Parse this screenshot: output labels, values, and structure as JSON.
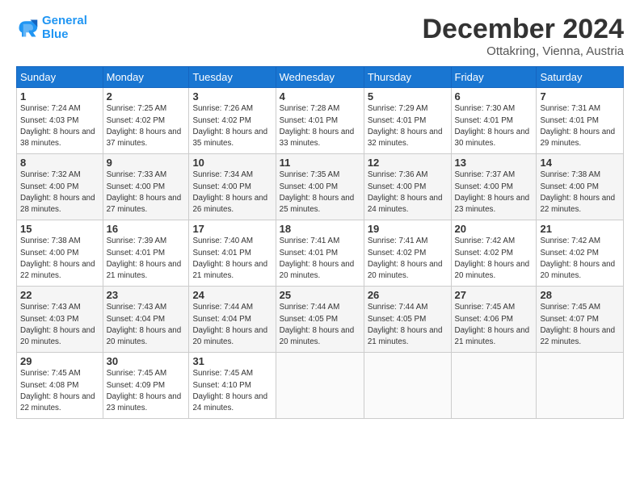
{
  "logo": {
    "line1": "General",
    "line2": "Blue"
  },
  "title": "December 2024",
  "subtitle": "Ottakring, Vienna, Austria",
  "days_of_week": [
    "Sunday",
    "Monday",
    "Tuesday",
    "Wednesday",
    "Thursday",
    "Friday",
    "Saturday"
  ],
  "weeks": [
    [
      {
        "day": "1",
        "sunrise": "7:24 AM",
        "sunset": "4:03 PM",
        "daylight": "8 hours and 38 minutes."
      },
      {
        "day": "2",
        "sunrise": "7:25 AM",
        "sunset": "4:02 PM",
        "daylight": "8 hours and 37 minutes."
      },
      {
        "day": "3",
        "sunrise": "7:26 AM",
        "sunset": "4:02 PM",
        "daylight": "8 hours and 35 minutes."
      },
      {
        "day": "4",
        "sunrise": "7:28 AM",
        "sunset": "4:01 PM",
        "daylight": "8 hours and 33 minutes."
      },
      {
        "day": "5",
        "sunrise": "7:29 AM",
        "sunset": "4:01 PM",
        "daylight": "8 hours and 32 minutes."
      },
      {
        "day": "6",
        "sunrise": "7:30 AM",
        "sunset": "4:01 PM",
        "daylight": "8 hours and 30 minutes."
      },
      {
        "day": "7",
        "sunrise": "7:31 AM",
        "sunset": "4:01 PM",
        "daylight": "8 hours and 29 minutes."
      }
    ],
    [
      {
        "day": "8",
        "sunrise": "7:32 AM",
        "sunset": "4:00 PM",
        "daylight": "8 hours and 28 minutes."
      },
      {
        "day": "9",
        "sunrise": "7:33 AM",
        "sunset": "4:00 PM",
        "daylight": "8 hours and 27 minutes."
      },
      {
        "day": "10",
        "sunrise": "7:34 AM",
        "sunset": "4:00 PM",
        "daylight": "8 hours and 26 minutes."
      },
      {
        "day": "11",
        "sunrise": "7:35 AM",
        "sunset": "4:00 PM",
        "daylight": "8 hours and 25 minutes."
      },
      {
        "day": "12",
        "sunrise": "7:36 AM",
        "sunset": "4:00 PM",
        "daylight": "8 hours and 24 minutes."
      },
      {
        "day": "13",
        "sunrise": "7:37 AM",
        "sunset": "4:00 PM",
        "daylight": "8 hours and 23 minutes."
      },
      {
        "day": "14",
        "sunrise": "7:38 AM",
        "sunset": "4:00 PM",
        "daylight": "8 hours and 22 minutes."
      }
    ],
    [
      {
        "day": "15",
        "sunrise": "7:38 AM",
        "sunset": "4:00 PM",
        "daylight": "8 hours and 22 minutes."
      },
      {
        "day": "16",
        "sunrise": "7:39 AM",
        "sunset": "4:01 PM",
        "daylight": "8 hours and 21 minutes."
      },
      {
        "day": "17",
        "sunrise": "7:40 AM",
        "sunset": "4:01 PM",
        "daylight": "8 hours and 21 minutes."
      },
      {
        "day": "18",
        "sunrise": "7:41 AM",
        "sunset": "4:01 PM",
        "daylight": "8 hours and 20 minutes."
      },
      {
        "day": "19",
        "sunrise": "7:41 AM",
        "sunset": "4:02 PM",
        "daylight": "8 hours and 20 minutes."
      },
      {
        "day": "20",
        "sunrise": "7:42 AM",
        "sunset": "4:02 PM",
        "daylight": "8 hours and 20 minutes."
      },
      {
        "day": "21",
        "sunrise": "7:42 AM",
        "sunset": "4:02 PM",
        "daylight": "8 hours and 20 minutes."
      }
    ],
    [
      {
        "day": "22",
        "sunrise": "7:43 AM",
        "sunset": "4:03 PM",
        "daylight": "8 hours and 20 minutes."
      },
      {
        "day": "23",
        "sunrise": "7:43 AM",
        "sunset": "4:04 PM",
        "daylight": "8 hours and 20 minutes."
      },
      {
        "day": "24",
        "sunrise": "7:44 AM",
        "sunset": "4:04 PM",
        "daylight": "8 hours and 20 minutes."
      },
      {
        "day": "25",
        "sunrise": "7:44 AM",
        "sunset": "4:05 PM",
        "daylight": "8 hours and 20 minutes."
      },
      {
        "day": "26",
        "sunrise": "7:44 AM",
        "sunset": "4:05 PM",
        "daylight": "8 hours and 21 minutes."
      },
      {
        "day": "27",
        "sunrise": "7:45 AM",
        "sunset": "4:06 PM",
        "daylight": "8 hours and 21 minutes."
      },
      {
        "day": "28",
        "sunrise": "7:45 AM",
        "sunset": "4:07 PM",
        "daylight": "8 hours and 22 minutes."
      }
    ],
    [
      {
        "day": "29",
        "sunrise": "7:45 AM",
        "sunset": "4:08 PM",
        "daylight": "8 hours and 22 minutes."
      },
      {
        "day": "30",
        "sunrise": "7:45 AM",
        "sunset": "4:09 PM",
        "daylight": "8 hours and 23 minutes."
      },
      {
        "day": "31",
        "sunrise": "7:45 AM",
        "sunset": "4:10 PM",
        "daylight": "8 hours and 24 minutes."
      },
      null,
      null,
      null,
      null
    ]
  ]
}
